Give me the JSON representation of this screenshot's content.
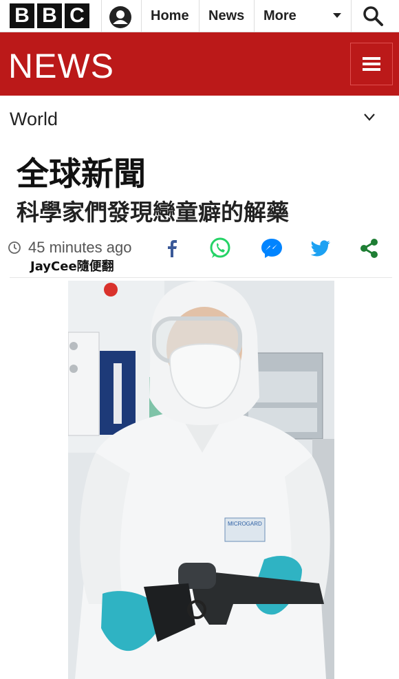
{
  "topbar": {
    "logo_letters": [
      "B",
      "B",
      "C"
    ],
    "nav": [
      "Home",
      "News",
      "More"
    ],
    "icons": [
      "account-icon",
      "chevron-down-icon",
      "search-icon"
    ]
  },
  "banner": {
    "logo_text": "NEWS",
    "brand_color": "#bb1919"
  },
  "section": {
    "label": "World"
  },
  "article": {
    "headline": "全球新聞",
    "subheadline": "科學家們發現戀童癖的解藥",
    "timestamp": "45 minutes ago",
    "author": "JayCee隨便翻",
    "share_icons": [
      "facebook-icon",
      "whatsapp-icon",
      "messenger-icon",
      "twitter-icon",
      "share-icon"
    ]
  },
  "photo": {
    "badge_text": "MICROGARD"
  }
}
